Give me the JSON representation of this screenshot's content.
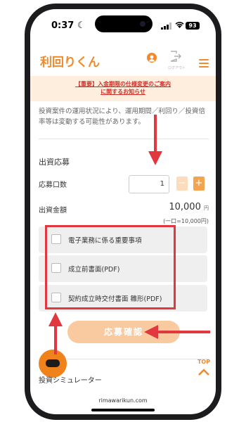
{
  "status_bar": {
    "time": "0:37",
    "moon_icon": "moon-icon",
    "battery": "93"
  },
  "header": {
    "logo": "利回りくん",
    "logout_label": "ログアウト",
    "user_icon": "user-icon",
    "menu_icon": "hamburger-menu-icon"
  },
  "notice": {
    "line1": "【重要】入金期限の仕様変更のご案内",
    "line2": "に関するお知らせ"
  },
  "disclaimer": "投資案件の運用状況により、運用期間／利回り／投資倍率等は変動する可能性があります。",
  "form": {
    "section_title": "出資応募",
    "quantity_label": "応募口数",
    "quantity_value": "1",
    "minus_label": "−",
    "plus_label": "+",
    "amount_label": "出資金額",
    "amount_value": "10,000",
    "amount_unit": "円",
    "unit_note": "(一口=10,000円)",
    "checkboxes": [
      {
        "label": "電子業務に係る重要事項"
      },
      {
        "label": "成立前書面(PDF)"
      },
      {
        "label": "契約成立時交付書面 雛形(PDF)"
      }
    ],
    "submit_label": "応募確認"
  },
  "footer": {
    "top_label": "TOP",
    "simulator_title": "投資シミュレーター",
    "url": "rimawarikun.com"
  },
  "colors": {
    "brand_orange": "#f08a2c",
    "notice_bg": "#fdeedd",
    "notice_text": "#d0302a",
    "annotation_red": "#e0383e"
  }
}
